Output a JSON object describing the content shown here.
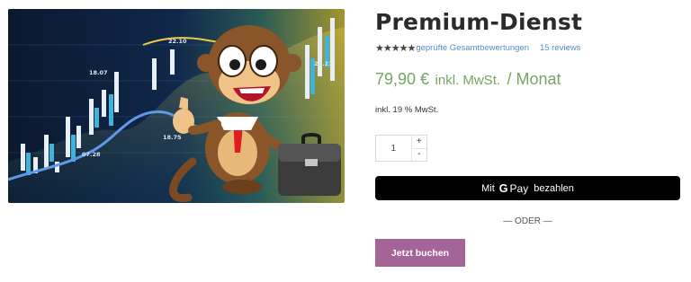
{
  "product": {
    "title": "Premium-Dienst",
    "stars": "★★★★★",
    "rating_link": "geprüfte Gesamtbewertungen",
    "reviews_link": "15 reviews",
    "price_amount": "79,90 €",
    "price_suffix": "inkl. MwSt.",
    "price_period": "/ Monat",
    "tax_note": "inkl. 19 % MwSt.",
    "quantity": "1",
    "qty_plus": "+",
    "qty_minus": "-",
    "gpay_prefix": "Mit",
    "gpay_g": "G",
    "gpay_brand": "Pay",
    "gpay_suffix": "bezahlen",
    "divider": "— ODER —",
    "book_label": "Jetzt buchen"
  },
  "image": {
    "tickers": [
      "18.07",
      "22.10",
      "25.21",
      "18.75",
      "07.28"
    ]
  },
  "colors": {
    "price_green": "#77a464",
    "link_blue": "#5a8ec7",
    "book_purple": "#a46497",
    "gpay_black": "#000000"
  }
}
